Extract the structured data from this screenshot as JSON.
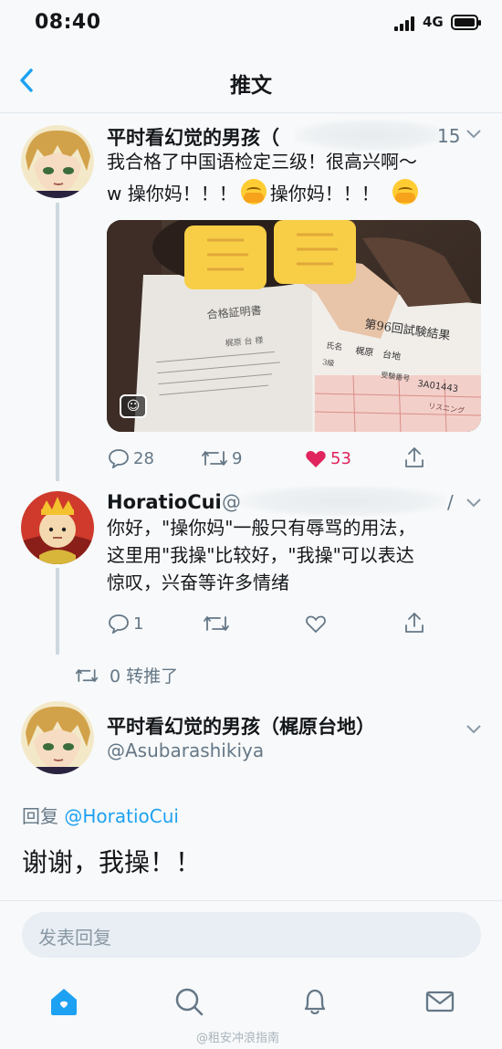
{
  "status_bar": {
    "time": "08:40",
    "network": "4G"
  },
  "nav": {
    "back_icon": "chevron-left-icon",
    "title": "推文"
  },
  "tweet1": {
    "name": "平时看幻觉的男孩（",
    "time_fragment": "15",
    "text_line1": "我合格了中国语检定三级！很高兴啊～",
    "text_line2a": "w 操你妈！！！",
    "text_line2b": "操你妈！！！",
    "photo": {
      "left_doc_title": "合格証明書",
      "left_doc_name": "梶原 台 様",
      "right_doc_title": "第96回試験結果",
      "right_doc_name_label": "氏名",
      "right_doc_name": "梶原　台地",
      "right_doc_level": "3級",
      "right_doc_num_label": "受験番号",
      "right_doc_num": "3A01443",
      "right_doc_table": "リスニング"
    },
    "replies": "28",
    "retweets": "9",
    "likes": "53"
  },
  "reply1": {
    "name": "HoratioCui",
    "handle_prefix": "@",
    "handle_end": "/",
    "text_line1": "你好，\"操你妈\"一般只有辱骂的用法，",
    "text_line2": "这里用\"我操\"比较好，\"我操\"可以表达",
    "text_line3": "惊叹，兴奋等许多情绪",
    "replies": "1"
  },
  "retweet_info": {
    "text": "0 转推了"
  },
  "main_tweet": {
    "name": "平时看幻觉的男孩（梶原台地）",
    "handle": "@Asubarashikiya",
    "reply_label": "回复",
    "reply_to": "@HoratioCui",
    "text": "谢谢，我操！！"
  },
  "compose": {
    "placeholder": "发表回复"
  },
  "tabbar": {
    "items": [
      "home-icon",
      "search-icon",
      "notifications-icon",
      "messages-icon"
    ]
  },
  "watermark": {
    "text": "@租安冲浪指南"
  },
  "colors": {
    "accent": "#1da1f2",
    "like": "#e0245e",
    "text": "#14171a",
    "muted": "#657786"
  }
}
